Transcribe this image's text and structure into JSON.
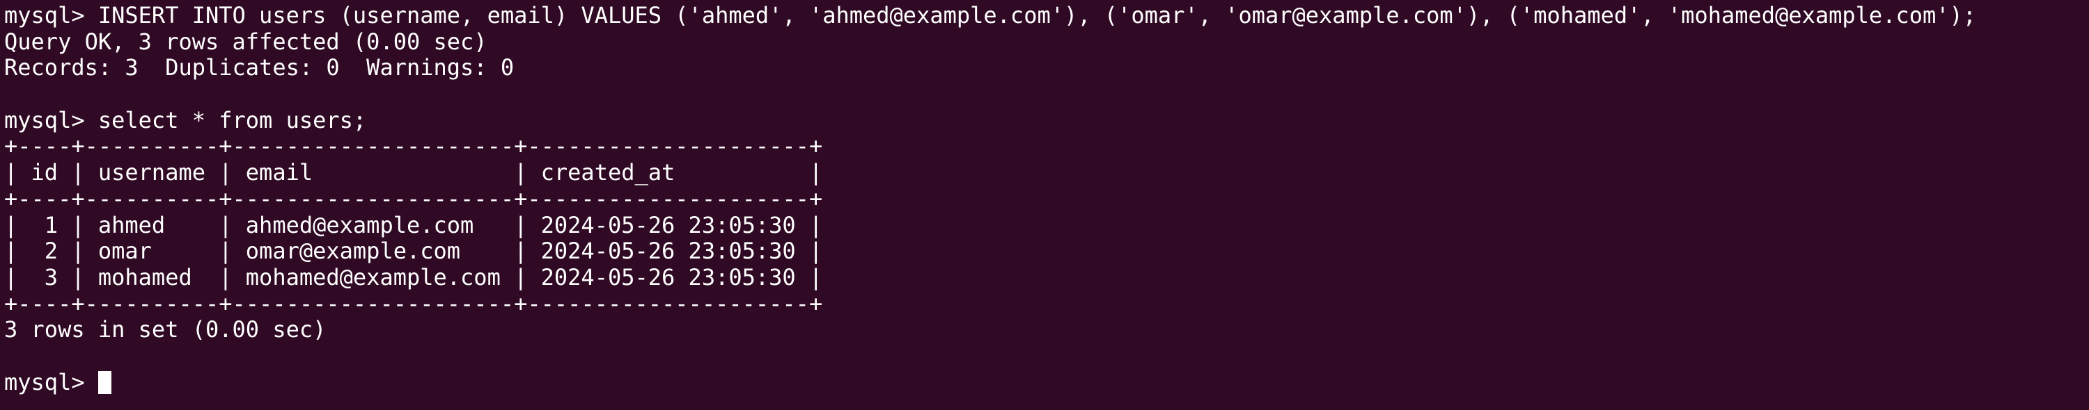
{
  "terminal": {
    "background": "#300a24",
    "foreground": "#ffffff",
    "lines": [
      "mysql> INSERT INTO users (username, email) VALUES ('ahmed', 'ahmed@example.com'), ('omar', 'omar@example.com'), ('mohamed', 'mohamed@example.com');",
      "Query OK, 3 rows affected (0.00 sec)",
      "Records: 3  Duplicates: 0  Warnings: 0",
      "",
      "mysql> select * from users;",
      "+----+----------+---------------------+---------------------+",
      "| id | username | email               | created_at          |",
      "+----+----------+---------------------+---------------------+",
      "|  1 | ahmed    | ahmed@example.com   | 2024-05-26 23:05:30 |",
      "|  2 | omar     | omar@example.com    | 2024-05-26 23:05:30 |",
      "|  3 | mohamed  | mohamed@example.com | 2024-05-26 23:05:30 |",
      "+----+----------+---------------------+---------------------+",
      "3 rows in set (0.00 sec)",
      ""
    ],
    "prompt": "mysql> "
  }
}
